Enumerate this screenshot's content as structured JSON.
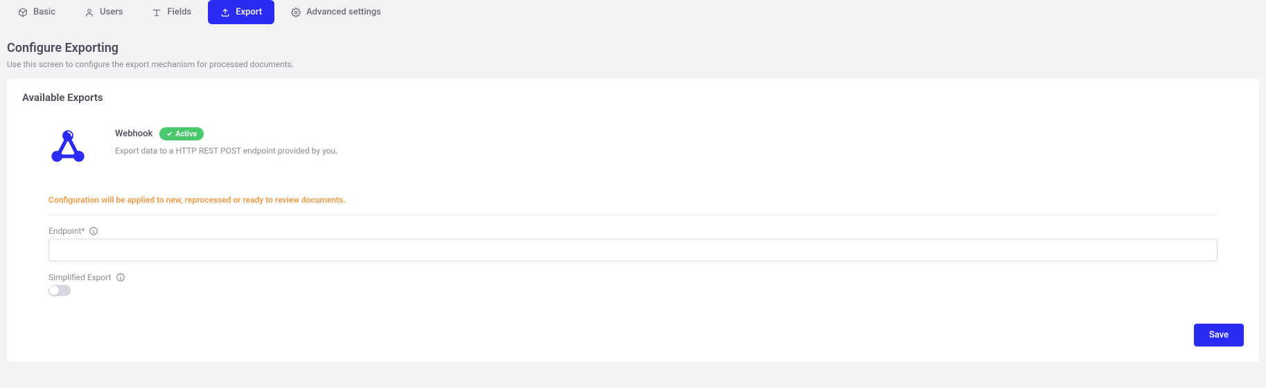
{
  "tabs": {
    "basic": "Basic",
    "users": "Users",
    "fields": "Fields",
    "export": "Export",
    "advanced": "Advanced settings"
  },
  "header": {
    "title": "Configure Exporting",
    "subtitle": "Use this screen to configure the export mechanism for processed documents."
  },
  "section": {
    "available_title": "Available Exports"
  },
  "webhook": {
    "name": "Webhook",
    "badge": "Active",
    "desc": "Export data to a HTTP REST POST endpoint provided by you."
  },
  "config": {
    "warning": "Configuration will be applied to new, reprocessed or ready to review documents.",
    "endpoint_label": "Endpoint*",
    "endpoint_value": "",
    "simplified_label": "Simplified Export",
    "simplified_on": false
  },
  "actions": {
    "save": "Save"
  }
}
